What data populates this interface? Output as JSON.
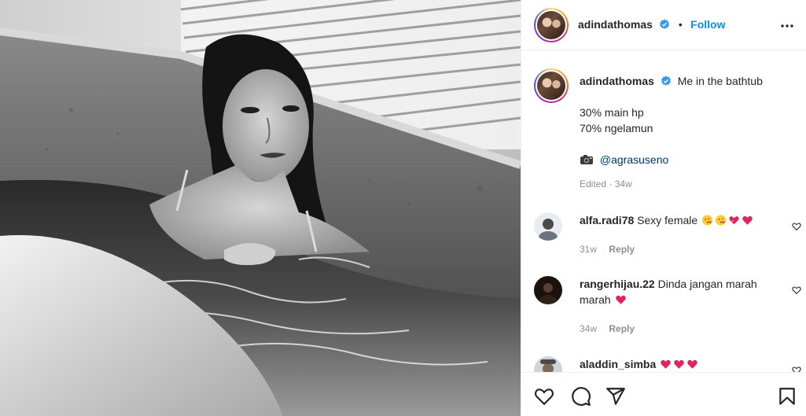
{
  "post": {
    "author": "adindathomas",
    "follow_label": "Follow",
    "separator": "•",
    "caption_text": "Me in the bathtub",
    "caption_lines": [
      "30% main hp",
      "70% ngelamun"
    ],
    "photo_credit_icon": "camera-emoji",
    "photo_credit": "@agrasuseno",
    "edited_meta": "Edited · 34w"
  },
  "comments": [
    {
      "user": "alfa.radi78",
      "text": "Sexy female",
      "emojis": [
        "face-blowing-kiss",
        "face-blowing-kiss",
        "two-hearts",
        "red-heart"
      ],
      "time": "31w",
      "reply": "Reply"
    },
    {
      "user": "rangerhijau.22",
      "text": "Dinda jangan marah marah",
      "emojis": [
        "red-heart"
      ],
      "time": "34w",
      "reply": "Reply"
    },
    {
      "user": "aladdin_simba",
      "text": "",
      "emojis": [
        "red-heart",
        "red-heart",
        "red-heart"
      ]
    }
  ],
  "icons": {
    "verified": "verified-badge-icon",
    "more": "more-options-icon",
    "like": "heart-icon",
    "comment": "comment-icon",
    "share": "share-icon",
    "save": "bookmark-icon"
  },
  "colors": {
    "accent": "#0095f6",
    "text": "#262626",
    "muted": "#8e8e8e",
    "mention": "#00376b",
    "heart": "#e0245e"
  }
}
